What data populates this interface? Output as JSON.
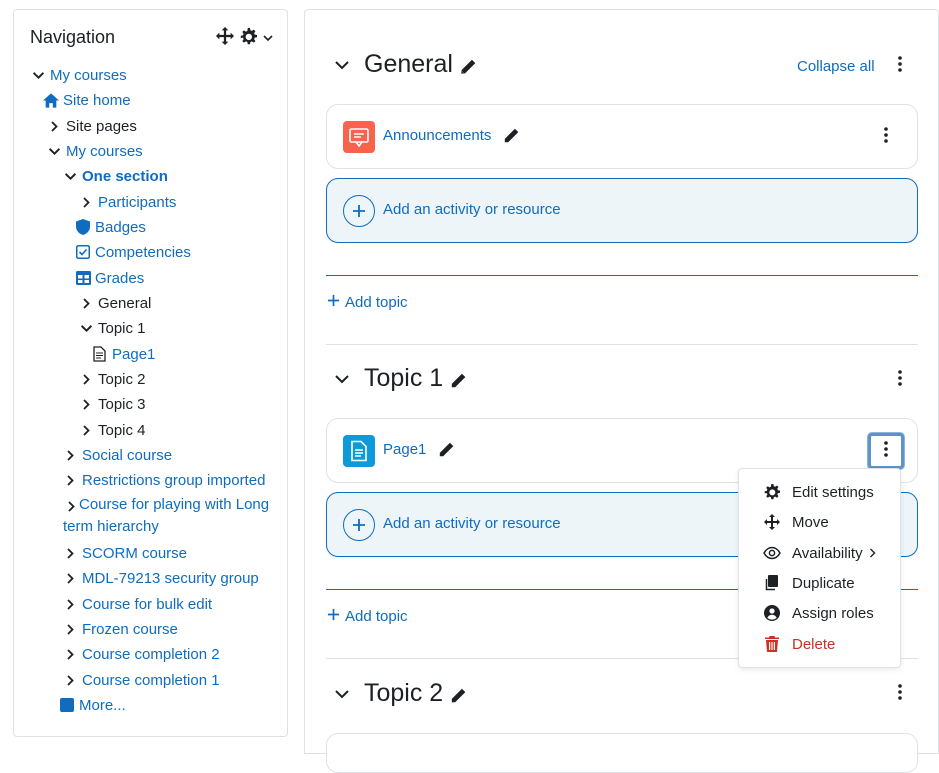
{
  "navigation": {
    "title": "Navigation",
    "items": [
      {
        "label": "My courses"
      },
      {
        "label": "Site home"
      },
      {
        "label": "Site pages"
      },
      {
        "label": "My courses"
      },
      {
        "label": "One section"
      },
      {
        "label": "Participants"
      },
      {
        "label": "Badges"
      },
      {
        "label": "Competencies"
      },
      {
        "label": "Grades"
      },
      {
        "label": "General"
      },
      {
        "label": "Topic 1"
      },
      {
        "label": "Page1"
      },
      {
        "label": "Topic 2"
      },
      {
        "label": "Topic 3"
      },
      {
        "label": "Topic 4"
      },
      {
        "label": "Social course"
      },
      {
        "label": "Restrictions group imported"
      },
      {
        "label": "Course for playing with Long term hierarchy"
      },
      {
        "label": "SCORM course"
      },
      {
        "label": "MDL-79213 security group"
      },
      {
        "label": "Course for bulk edit"
      },
      {
        "label": "Frozen course"
      },
      {
        "label": "Course completion 2"
      },
      {
        "label": "Course completion 1"
      },
      {
        "label": "More..."
      }
    ]
  },
  "content": {
    "collapse_all": "Collapse all",
    "add_activity_label": "Add an activity or resource",
    "add_topic_label": "Add topic",
    "sections": [
      {
        "title": "General",
        "activities": [
          {
            "name": "Announcements",
            "icon": "forum-icon"
          }
        ]
      },
      {
        "title": "Topic 1",
        "activities": [
          {
            "name": "Page1",
            "icon": "page-icon"
          }
        ]
      },
      {
        "title": "Topic 2",
        "activities": []
      }
    ]
  },
  "action_menu": {
    "items": [
      {
        "label": "Edit settings",
        "icon": "gear-icon"
      },
      {
        "label": "Move",
        "icon": "move-icon"
      },
      {
        "label": "Availability",
        "icon": "eye-icon"
      },
      {
        "label": "Duplicate",
        "icon": "copy-icon"
      },
      {
        "label": "Assign roles",
        "icon": "user-circle-icon"
      },
      {
        "label": "Delete",
        "icon": "trash-icon"
      }
    ]
  },
  "colors": {
    "link": "#0f6cbf",
    "text": "#1d2125",
    "danger": "#ca3120",
    "forum_icon_bg": "#f7634d",
    "page_icon_bg": "#0d9ad8",
    "add_activity_bg": "#eef5f9"
  }
}
